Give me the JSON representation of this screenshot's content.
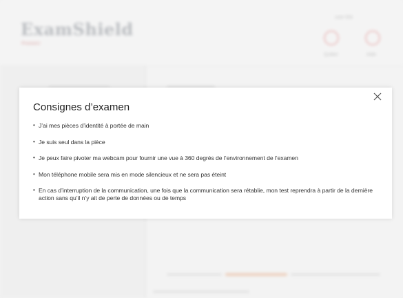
{
  "background": {
    "logo_text": "ExamShield",
    "logo_sub": "ProctorU",
    "user_label": "user link",
    "call_label": "Quitter",
    "help_label": "Aide"
  },
  "modal": {
    "title": "Consignes d’examen",
    "close_glyph": "✕",
    "rules": [
      "J’ai mes pièces d’identité à portée de main",
      "Je suis seul dans la pièce",
      "Je peux faire pivoter ma webcam pour fournir une vue à 360 degrés de l’environnement de l’examen",
      "Mon téléphone mobile sera mis en mode silencieux et ne sera pas éteint",
      "En cas d’interruption de la communication, une fois que la communication sera rétablie, mon test reprendra à partir de la dernière action sans qu’il n’y ait de perte de données ou de temps"
    ]
  },
  "colors": {
    "modal_bg": "#ffffff",
    "text": "#333333",
    "accent_red": "#e59a9a"
  },
  "icons": [
    "close-icon",
    "phone-icon",
    "help-icon"
  ]
}
